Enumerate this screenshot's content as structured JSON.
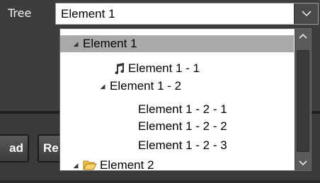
{
  "tree_field": {
    "label": "Tree",
    "selected_value": "Element 1"
  },
  "buttons": {
    "left_label": "ad",
    "right_label": "Re"
  },
  "tree_items": [
    {
      "label": "Element 1",
      "expanded": true,
      "selected": true,
      "icon": ""
    },
    {
      "label": "Element 1 - 1",
      "icon": "music-note-icon"
    },
    {
      "label": "Element 1 - 2",
      "expanded": true,
      "icon": ""
    },
    {
      "label": "Element 1 - 2 - 1",
      "icon": ""
    },
    {
      "label": "Element 1 - 2 - 2",
      "icon": ""
    },
    {
      "label": "Element 1 - 2 - 3",
      "icon": ""
    },
    {
      "label": "Element 2",
      "expanded": true,
      "icon": "folder-open-icon"
    }
  ],
  "colors": {
    "selected_row": "#a9a9a9",
    "folder_icon": "#e8a21e"
  }
}
